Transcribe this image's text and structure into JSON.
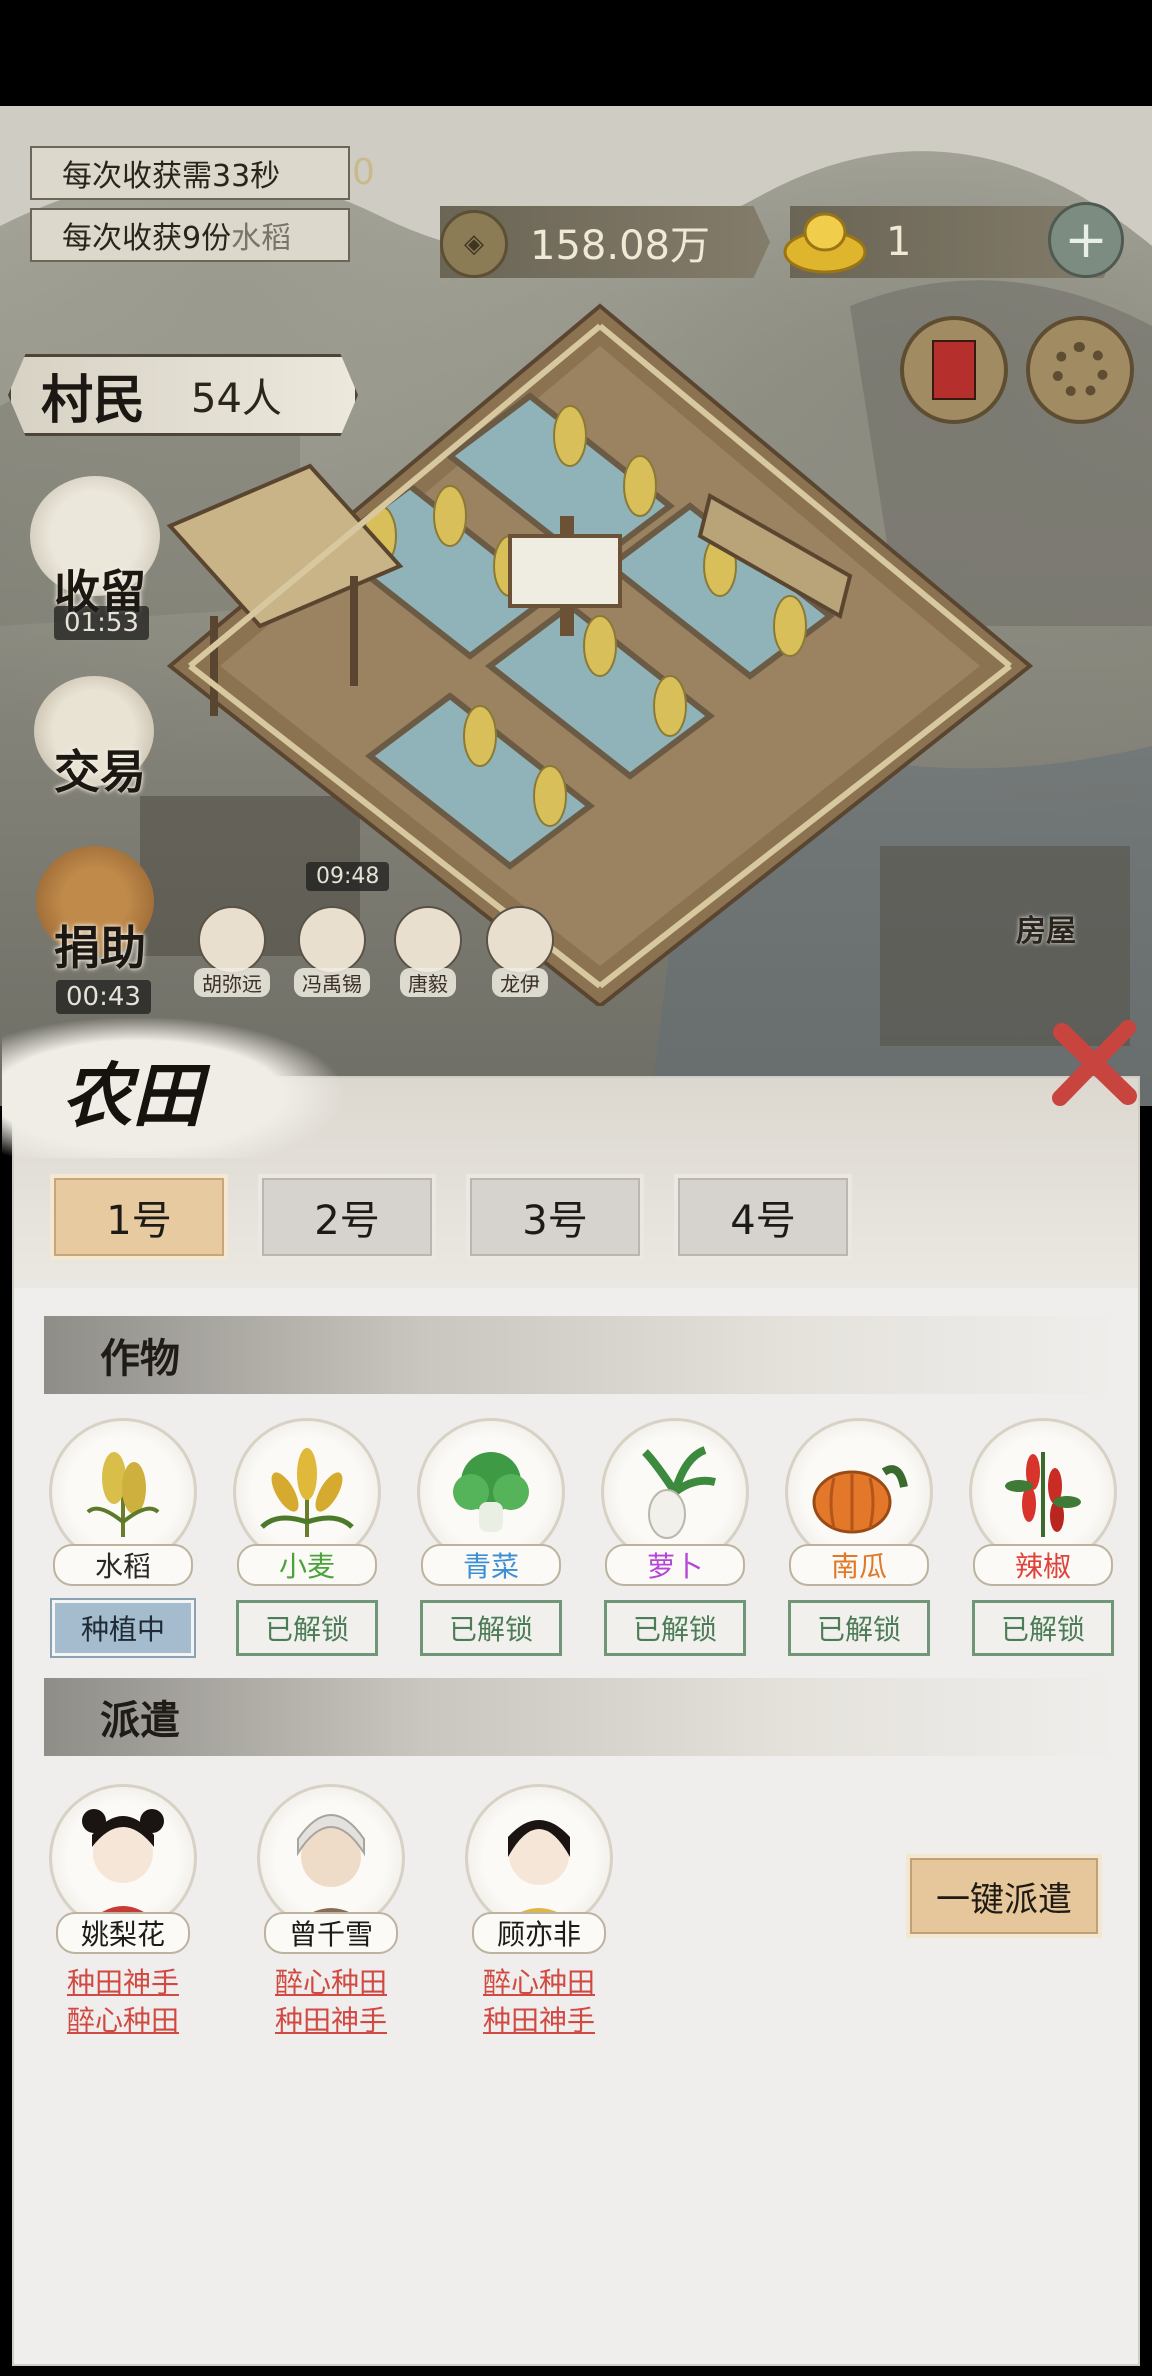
{
  "hud": {
    "harvest_time": "每次收获需33秒",
    "harvest_amount_prefix": "每次收获9份",
    "harvest_amount_crop": "水稻",
    "hidden_counter": "0",
    "copper_coins": "158.08万",
    "gold_ingots": "1",
    "add_symbol": "+",
    "villagers_label": "村民",
    "villagers_count": "54人"
  },
  "side_menu": {
    "collect_label": "收留",
    "collect_timer": "01:53",
    "trade_label": "交易",
    "donate_label": "捐助",
    "donate_timer": "00:43"
  },
  "scene": {
    "work_timer": "09:48",
    "house_label": "房屋",
    "npcs": [
      "胡弥远",
      "冯禹锡",
      "唐毅",
      "龙伊"
    ]
  },
  "panel": {
    "title": "农田",
    "plots": [
      "1号",
      "2号",
      "3号",
      "4号"
    ],
    "crops_section": "作物",
    "crops": [
      {
        "name": "水稻",
        "color": "#2a2622",
        "status": "种植中"
      },
      {
        "name": "小麦",
        "color": "#4aa33a",
        "status": "已解锁"
      },
      {
        "name": "青菜",
        "color": "#3b8fd6",
        "status": "已解锁"
      },
      {
        "name": "萝卜",
        "color": "#b445d6",
        "status": "已解锁"
      },
      {
        "name": "南瓜",
        "color": "#e07a2a",
        "status": "已解锁"
      },
      {
        "name": "辣椒",
        "color": "#e0413a",
        "status": "已解锁"
      }
    ],
    "dispatch_section": "派遣",
    "workers": [
      {
        "name": "姚梨花",
        "skill1": "种田神手",
        "skill2": "醉心种田"
      },
      {
        "name": "曾千雪",
        "skill1": "醉心种田",
        "skill2": "种田神手"
      },
      {
        "name": "顾亦非",
        "skill1": "醉心种田",
        "skill2": "种田神手"
      }
    ],
    "dispatch_all": "一键派遣"
  }
}
